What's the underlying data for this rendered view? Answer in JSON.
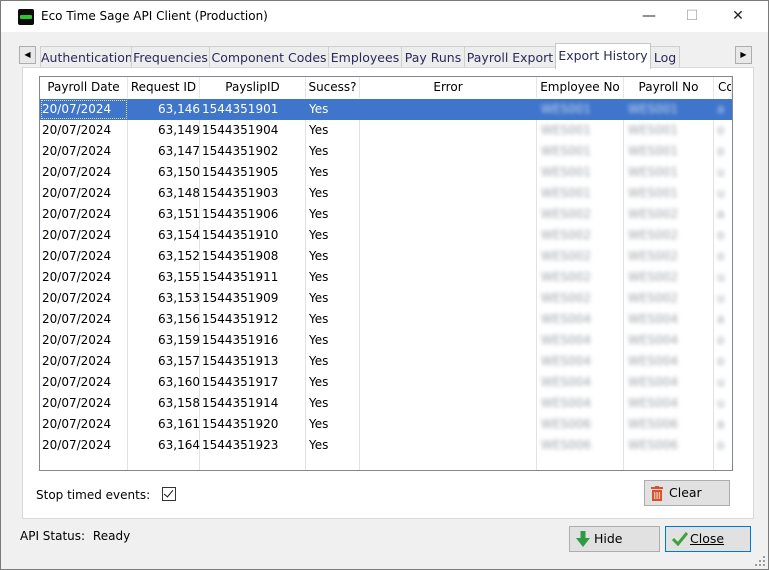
{
  "window": {
    "title": "Eco Time Sage API Client (Production)",
    "minimize_glyph": "—",
    "maximize_glyph": "☐",
    "close_glyph": "✕"
  },
  "tabs": [
    {
      "label": "Authentication"
    },
    {
      "label": "Frequencies"
    },
    {
      "label": "Component Codes"
    },
    {
      "label": "Employees"
    },
    {
      "label": "Pay Runs"
    },
    {
      "label": "Payroll Export"
    },
    {
      "label": "Export History",
      "active": true
    },
    {
      "label": "Log"
    }
  ],
  "grid": {
    "columns": [
      "Payroll Date",
      "Request ID",
      "PayslipID",
      "Sucess?",
      "Error",
      "Employee No",
      "Payroll No",
      "Co"
    ],
    "rows": [
      {
        "date": "20/07/2024",
        "request_id": "63,146",
        "payslip_id": "1544351901",
        "success": "Yes",
        "error": "",
        "employee_no": "WES001",
        "payroll_no": "WES001",
        "co": "a",
        "selected": true
      },
      {
        "date": "20/07/2024",
        "request_id": "63,149",
        "payslip_id": "1544351904",
        "success": "Yes",
        "error": "",
        "employee_no": "WES001",
        "payroll_no": "WES001",
        "co": "o"
      },
      {
        "date": "20/07/2024",
        "request_id": "63,147",
        "payslip_id": "1544351902",
        "success": "Yes",
        "error": "",
        "employee_no": "WES001",
        "payroll_no": "WES001",
        "co": "o"
      },
      {
        "date": "20/07/2024",
        "request_id": "63,150",
        "payslip_id": "1544351905",
        "success": "Yes",
        "error": "",
        "employee_no": "WES001",
        "payroll_no": "WES001",
        "co": "u"
      },
      {
        "date": "20/07/2024",
        "request_id": "63,148",
        "payslip_id": "1544351903",
        "success": "Yes",
        "error": "",
        "employee_no": "WES001",
        "payroll_no": "WES001",
        "co": "u"
      },
      {
        "date": "20/07/2024",
        "request_id": "63,151",
        "payslip_id": "1544351906",
        "success": "Yes",
        "error": "",
        "employee_no": "WES002",
        "payroll_no": "WES002",
        "co": "a"
      },
      {
        "date": "20/07/2024",
        "request_id": "63,154",
        "payslip_id": "1544351910",
        "success": "Yes",
        "error": "",
        "employee_no": "WES002",
        "payroll_no": "WES002",
        "co": "o"
      },
      {
        "date": "20/07/2024",
        "request_id": "63,152",
        "payslip_id": "1544351908",
        "success": "Yes",
        "error": "",
        "employee_no": "WES002",
        "payroll_no": "WES002",
        "co": "o"
      },
      {
        "date": "20/07/2024",
        "request_id": "63,155",
        "payslip_id": "1544351911",
        "success": "Yes",
        "error": "",
        "employee_no": "WES002",
        "payroll_no": "WES002",
        "co": "u"
      },
      {
        "date": "20/07/2024",
        "request_id": "63,153",
        "payslip_id": "1544351909",
        "success": "Yes",
        "error": "",
        "employee_no": "WES002",
        "payroll_no": "WES002",
        "co": "u"
      },
      {
        "date": "20/07/2024",
        "request_id": "63,156",
        "payslip_id": "1544351912",
        "success": "Yes",
        "error": "",
        "employee_no": "WES004",
        "payroll_no": "WES004",
        "co": "a"
      },
      {
        "date": "20/07/2024",
        "request_id": "63,159",
        "payslip_id": "1544351916",
        "success": "Yes",
        "error": "",
        "employee_no": "WES004",
        "payroll_no": "WES004",
        "co": "o"
      },
      {
        "date": "20/07/2024",
        "request_id": "63,157",
        "payslip_id": "1544351913",
        "success": "Yes",
        "error": "",
        "employee_no": "WES004",
        "payroll_no": "WES004",
        "co": "o"
      },
      {
        "date": "20/07/2024",
        "request_id": "63,160",
        "payslip_id": "1544351917",
        "success": "Yes",
        "error": "",
        "employee_no": "WES004",
        "payroll_no": "WES004",
        "co": "u"
      },
      {
        "date": "20/07/2024",
        "request_id": "63,158",
        "payslip_id": "1544351914",
        "success": "Yes",
        "error": "",
        "employee_no": "WES004",
        "payroll_no": "WES004",
        "co": "u"
      },
      {
        "date": "20/07/2024",
        "request_id": "63,161",
        "payslip_id": "1544351920",
        "success": "Yes",
        "error": "",
        "employee_no": "WES006",
        "payroll_no": "WES006",
        "co": "a"
      },
      {
        "date": "20/07/2024",
        "request_id": "63,164",
        "payslip_id": "1544351923",
        "success": "Yes",
        "error": "",
        "employee_no": "WES006",
        "payroll_no": "WES006",
        "co": "o"
      }
    ]
  },
  "stop_timed_events": {
    "label": "Stop timed events:",
    "checked": true
  },
  "buttons": {
    "clear": {
      "label": "Clear",
      "icon": "trash-icon"
    },
    "hide": {
      "label": "Hide",
      "icon": "arrow-down-icon"
    },
    "close": {
      "label": "Close",
      "icon": "checkmark-icon"
    }
  },
  "status": {
    "label": "API Status:",
    "value": "Ready"
  },
  "colors": {
    "selection": "#3f75cb",
    "clear_icon": "#d9502b",
    "hide_icon": "#2e9b47",
    "close_icon": "#3aa33a"
  }
}
